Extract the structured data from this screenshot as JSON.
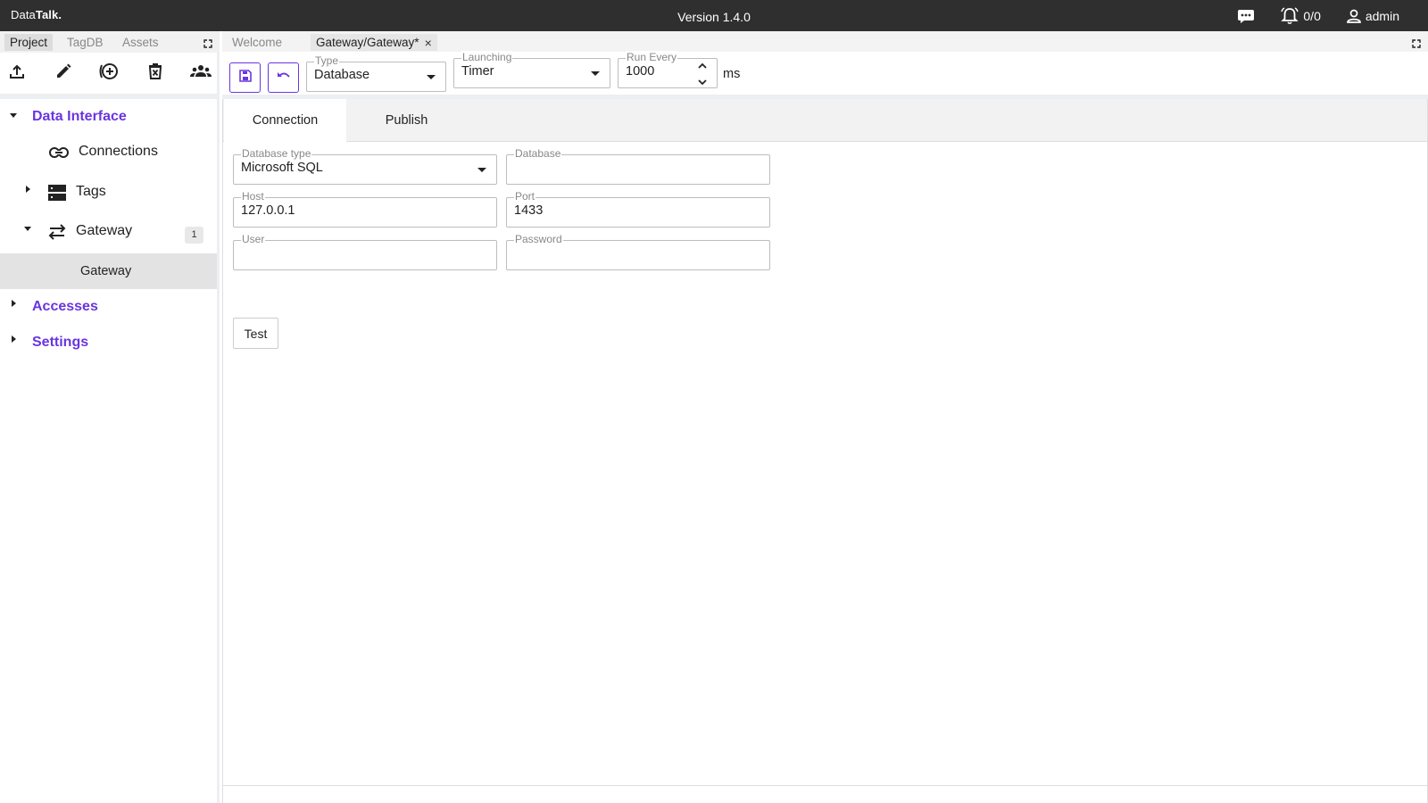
{
  "topbar": {
    "brand_regular": "Data",
    "brand_bold": "Talk.",
    "version": "Version 1.4.0",
    "alarms": "0/0",
    "user": "admin"
  },
  "left_tabs": [
    "Project",
    "TagDB",
    "Assets"
  ],
  "left_toolbar": [
    "upload-icon",
    "edit-icon",
    "add-circle-icon",
    "delete-icon",
    "group-icon"
  ],
  "tree": {
    "data_interface": "Data Interface",
    "connections": "Connections",
    "tags": "Tags",
    "gateway": "Gateway",
    "gateway_badge": "1",
    "gateway_child": "Gateway",
    "accesses": "Accesses",
    "settings": "Settings"
  },
  "doc_tabs": {
    "welcome": "Welcome",
    "active": "Gateway/Gateway*",
    "close": "×"
  },
  "toolbar": {
    "type_label": "Type",
    "type_value": "Database",
    "launching_label": "Launching",
    "launching_value": "Timer",
    "run_every_label": "Run Every",
    "run_every_value": "1000",
    "unit": "ms"
  },
  "content_tabs": [
    "Connection",
    "Publish"
  ],
  "form": {
    "db_type_label": "Database type",
    "db_type_value": "Microsoft SQL",
    "database_label": "Database",
    "database_value": "",
    "host_label": "Host",
    "host_value": "127.0.0.1",
    "port_label": "Port",
    "port_value": "1433",
    "user_label": "User",
    "user_value": "",
    "password_label": "Password",
    "password_value": "",
    "test_label": "Test"
  },
  "colors": {
    "accent": "#6a35e0",
    "topbar": "#2f2f2f"
  }
}
